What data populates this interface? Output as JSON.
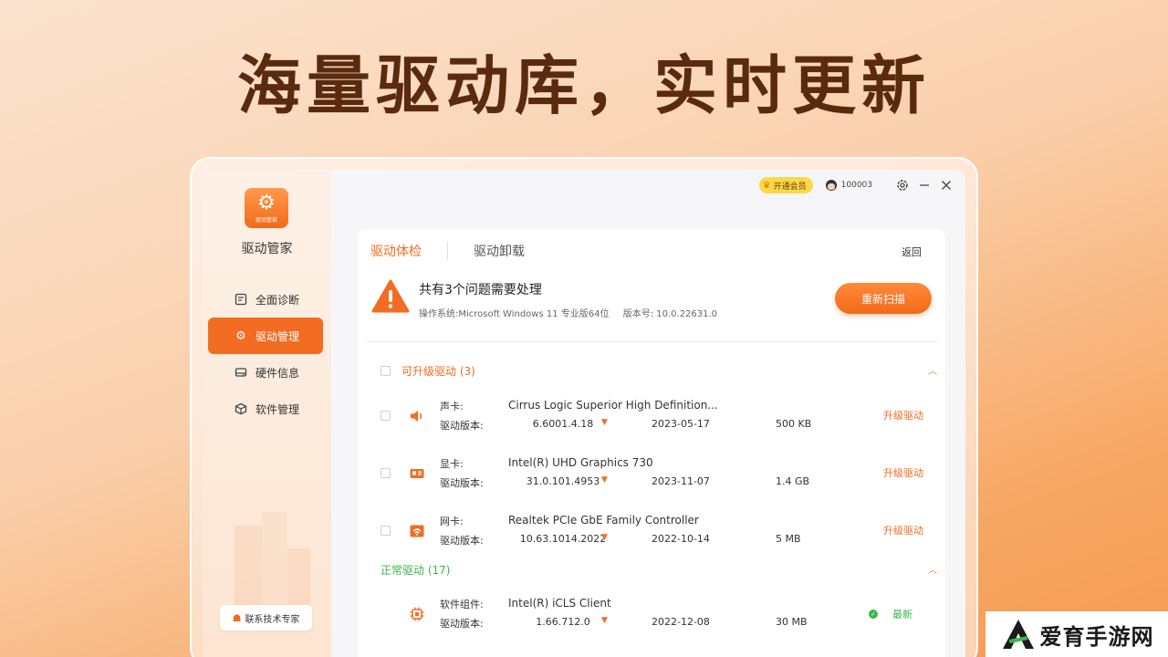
{
  "hero": {
    "title": "海量驱动库，实时更新"
  },
  "sidebar": {
    "logo_caption": "驱动管家",
    "app_name": "驱动管家",
    "items": [
      {
        "label": "全面诊断",
        "icon": "diagnosis-icon"
      },
      {
        "label": "驱动管理",
        "icon": "gear-icon",
        "active": true
      },
      {
        "label": "硬件信息",
        "icon": "hard-drive-icon"
      },
      {
        "label": "软件管理",
        "icon": "box-icon"
      }
    ],
    "support_label": "联系技术专家"
  },
  "titlebar": {
    "vip_label": "开通会员",
    "user_id": "100003"
  },
  "tabs": [
    "驱动体检",
    "驱动卸载"
  ],
  "back_label": "返回",
  "summary": {
    "title": "共有3个问题需要处理",
    "os": "操作系统:Microsoft Windows 11 专业版64位",
    "version": "版本号: 10.0.22631.0",
    "rescan_label": "重新扫描"
  },
  "sections": {
    "upgradable": {
      "title": "可升级驱动 (3)",
      "rows": [
        {
          "type": "声卡:",
          "ver_label": "驱动版本:",
          "name": "Cirrus Logic Superior High Definition...",
          "version": "6.6001.4.18",
          "date": "2023-05-17",
          "size": "500 KB",
          "action": "升级驱动",
          "icon": "speaker-icon"
        },
        {
          "type": "显卡:",
          "ver_label": "驱动版本:",
          "name": "Intel(R) UHD Graphics 730",
          "version": "31.0.101.4953",
          "date": "2023-11-07",
          "size": "1.4 GB",
          "action": "升级驱动",
          "icon": "graphics-card-icon"
        },
        {
          "type": "网卡:",
          "ver_label": "驱动版本:",
          "name": "Realtek PCIe GbE Family Controller",
          "version": "10.63.1014.2022",
          "date": "2022-10-14",
          "size": "5 MB",
          "action": "升级驱动",
          "icon": "network-card-icon"
        }
      ]
    },
    "normal": {
      "title": "正常驱动 (17)",
      "rows": [
        {
          "type": "软件组件:",
          "ver_label": "驱动版本:",
          "name": "Intel(R) iCLS Client",
          "version": "1.66.712.0",
          "date": "2022-12-08",
          "size": "30 MB",
          "status": "最新",
          "icon": "chip-icon"
        }
      ]
    }
  },
  "watermark": {
    "text": "爱育手游网"
  },
  "colors": {
    "accent": "#f26c22",
    "ok": "#3cb54a",
    "hero_text": "#5a2a0f"
  }
}
